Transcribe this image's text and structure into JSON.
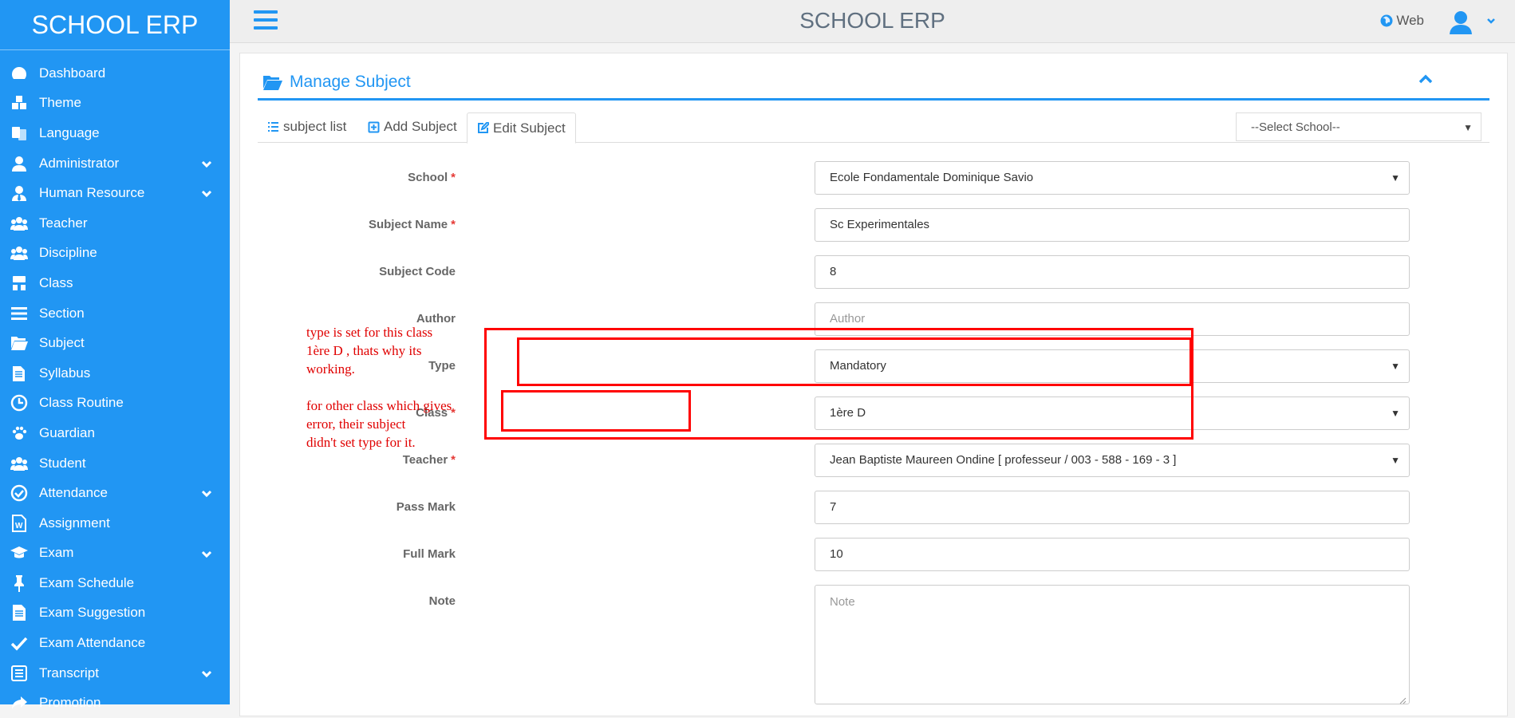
{
  "brand": "SCHOOL ERP",
  "header": {
    "title": "SCHOOL ERP",
    "web_label": "Web"
  },
  "sidebar": {
    "items": [
      {
        "label": "Dashboard",
        "icon": "dashboard-icon",
        "expandable": false
      },
      {
        "label": "Theme",
        "icon": "cubes-icon",
        "expandable": false
      },
      {
        "label": "Language",
        "icon": "language-icon",
        "expandable": false
      },
      {
        "label": "Administrator",
        "icon": "user-icon",
        "expandable": true
      },
      {
        "label": "Human Resource",
        "icon": "user-tie-icon",
        "expandable": true
      },
      {
        "label": "Teacher",
        "icon": "users-icon",
        "expandable": false
      },
      {
        "label": "Discipline",
        "icon": "users-icon",
        "expandable": false
      },
      {
        "label": "Class",
        "icon": "sitemap-icon",
        "expandable": false
      },
      {
        "label": "Section",
        "icon": "bars-icon",
        "expandable": false
      },
      {
        "label": "Subject",
        "icon": "folder-open-icon",
        "expandable": false
      },
      {
        "label": "Syllabus",
        "icon": "files-icon",
        "expandable": false
      },
      {
        "label": "Class Routine",
        "icon": "clock-icon",
        "expandable": false
      },
      {
        "label": "Guardian",
        "icon": "paw-icon",
        "expandable": false
      },
      {
        "label": "Student",
        "icon": "users-icon",
        "expandable": false
      },
      {
        "label": "Attendance",
        "icon": "check-circle-icon",
        "expandable": true
      },
      {
        "label": "Assignment",
        "icon": "word-file-icon",
        "expandable": false
      },
      {
        "label": "Exam",
        "icon": "graduation-cap-icon",
        "expandable": true
      },
      {
        "label": "Exam Schedule",
        "icon": "thumbtack-icon",
        "expandable": false
      },
      {
        "label": "Exam Suggestion",
        "icon": "file-text-icon",
        "expandable": false
      },
      {
        "label": "Exam Attendance",
        "icon": "check-icon",
        "expandable": false
      },
      {
        "label": "Transcript",
        "icon": "list-alt-icon",
        "expandable": true
      },
      {
        "label": "Promotion",
        "icon": "share-icon",
        "expandable": false
      }
    ]
  },
  "panel": {
    "title": "Manage Subject"
  },
  "tabs": [
    {
      "label": "subject list",
      "icon": "list-icon"
    },
    {
      "label": "Add Subject",
      "icon": "plus-square-icon"
    },
    {
      "label": "Edit Subject",
      "icon": "edit-icon"
    }
  ],
  "school_filter": {
    "selected": "--Select School--"
  },
  "form": {
    "school": {
      "label": "School",
      "required": true,
      "value": "Ecole Fondamentale Dominique Savio"
    },
    "subject_name": {
      "label": "Subject Name",
      "required": true,
      "value": "Sc Experimentales"
    },
    "subject_code": {
      "label": "Subject Code",
      "required": false,
      "value": "8"
    },
    "author": {
      "label": "Author",
      "required": false,
      "value": "",
      "placeholder": "Author"
    },
    "type": {
      "label": "Type",
      "required": false,
      "value": "Mandatory"
    },
    "class": {
      "label": "Class",
      "required": true,
      "value": "1ère D"
    },
    "teacher": {
      "label": "Teacher",
      "required": true,
      "value": "Jean Baptiste Maureen Ondine [ professeur / 003 - 588 - 169 - 3 ]"
    },
    "pass_mark": {
      "label": "Pass Mark",
      "required": false,
      "value": "7"
    },
    "full_mark": {
      "label": "Full Mark",
      "required": false,
      "value": "10"
    },
    "note": {
      "label": "Note",
      "required": false,
      "value": "",
      "placeholder": "Note"
    }
  },
  "annotation": {
    "line1": "type is set for this class\n1ère D , thats why its\nworking.",
    "line2": "for other class which gives\nerror, their subject\ndidn't set type for it.",
    "color": "#ff0000"
  },
  "colors": {
    "primary": "#2196f3",
    "required": "#e53935"
  }
}
